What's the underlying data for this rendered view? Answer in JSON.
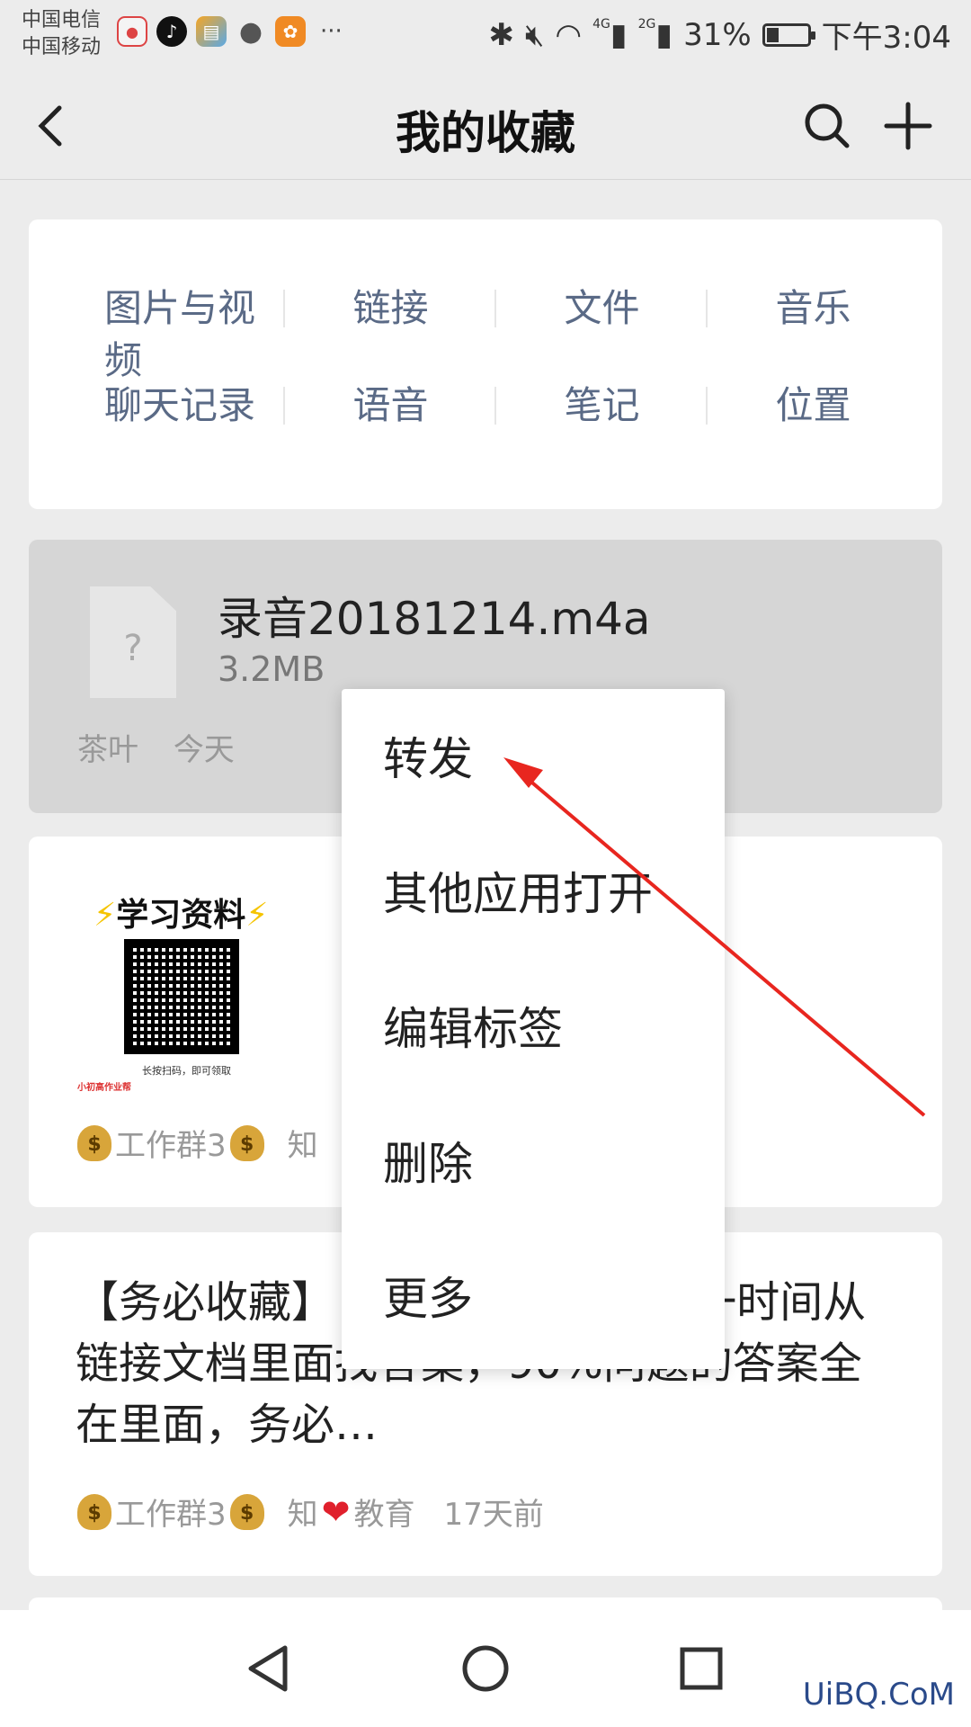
{
  "status_bar": {
    "carrier1": "中国电信",
    "carrier2": "中国移动",
    "more": "···",
    "network1": "4G",
    "network2": "2G",
    "battery_percent": "31%",
    "battery_level": 0.31,
    "time": "下午3:04"
  },
  "title_bar": {
    "title": "我的收藏"
  },
  "categories": [
    "图片与视频",
    "链接",
    "文件",
    "音乐",
    "聊天记录",
    "语音",
    "笔记",
    "位置"
  ],
  "file_item": {
    "name": "录音20181214.m4a",
    "size": "3.2MB",
    "unknown_glyph": "?",
    "source": "茶叶",
    "date": "今天"
  },
  "image_item": {
    "image_title": "学习资料",
    "image_caption": "长按扫码，即可领取",
    "image_brand": "小初高作业帮",
    "source_prefix": "工作群3",
    "source_suffix": "知"
  },
  "text_item": {
    "body": "【务必收藏】 必收藏】有问题第一时间从链接文档里面找答案，90%问题的答案全在里面，务必…",
    "source_prefix": "工作群3",
    "source_mid": "知",
    "source_suffix": "教育",
    "date": "17天前"
  },
  "context_menu": {
    "items": [
      "转发",
      "其他应用打开",
      "编辑标签",
      "删除",
      "更多"
    ]
  },
  "watermark": "UiBQ.CoM",
  "colors": {
    "background": "#ececec",
    "category_text": "#5a6a86",
    "annotation_arrow": "#e8261f",
    "highlight_card": "#d6d6d6"
  }
}
